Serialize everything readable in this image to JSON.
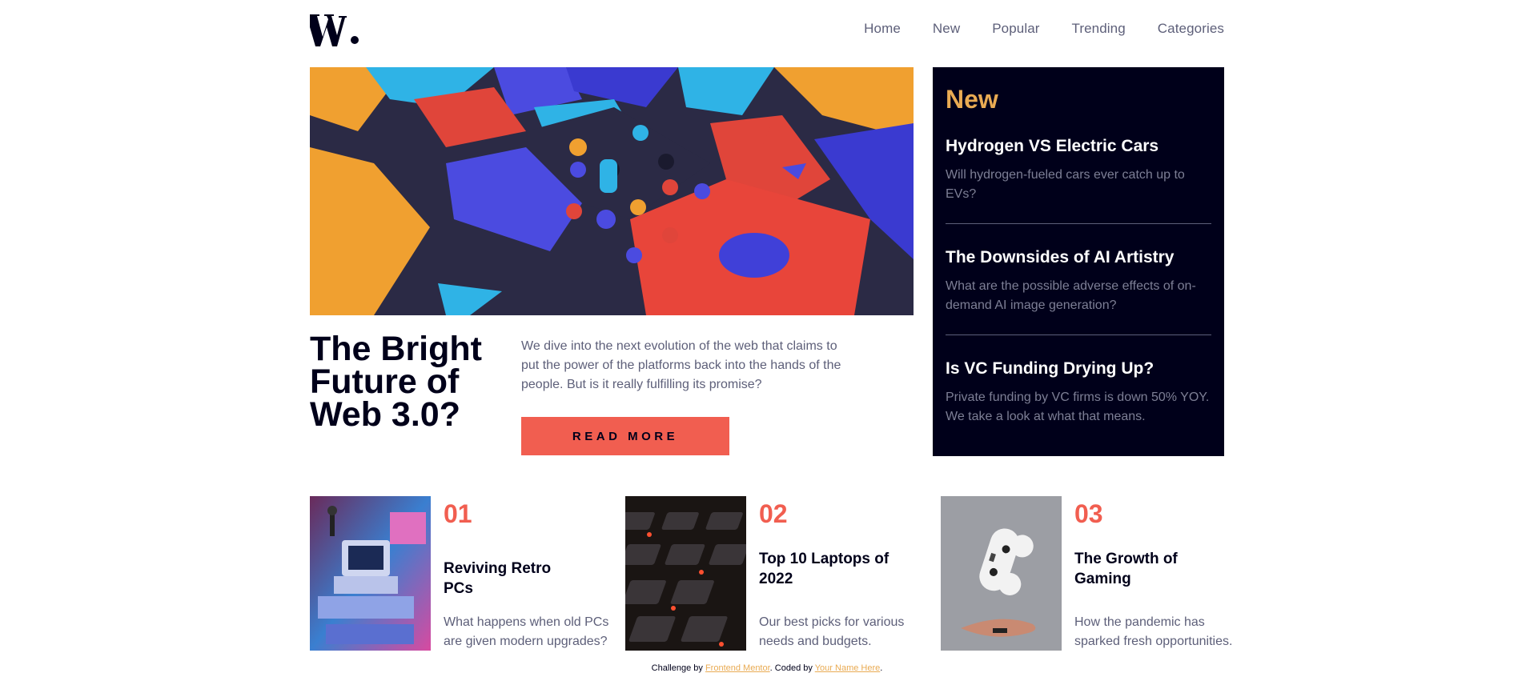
{
  "header": {
    "logo_text": "W.",
    "nav": [
      "Home",
      "New",
      "Popular",
      "Trending",
      "Categories"
    ]
  },
  "hero": {
    "image_icon": "abstract-3d-blocks-image",
    "title": "The Bright Future of Web 3.0?",
    "description": "We dive into the next evolution of the web that claims to put the power of the platforms back into the hands of the people. But is it really fulfilling its promise?",
    "button_label": "READ MORE"
  },
  "new_panel": {
    "heading": "New",
    "items": [
      {
        "title": "Hydrogen VS Electric Cars",
        "desc": "Will hydrogen-fueled cars ever catch up to EVs?"
      },
      {
        "title": "The Downsides of AI Artistry",
        "desc": "What are the possible adverse effects of on-demand AI image generation?"
      },
      {
        "title": "Is VC Funding Drying Up?",
        "desc": "Private funding by VC firms is down 50% YOY. We take a look at what that means."
      }
    ]
  },
  "cards": [
    {
      "num": "01",
      "title": "Reviving Retro PCs",
      "desc": "What happens when old PCs are given modern upgrades?",
      "image_icon": "retro-pc-image"
    },
    {
      "num": "02",
      "title": "Top 10 Laptops of 2022",
      "desc": "Our best picks for various needs and budgets.",
      "image_icon": "laptop-keyboard-image"
    },
    {
      "num": "03",
      "title": "The Growth of Gaming",
      "desc": "How the pandemic has sparked fresh opportunities.",
      "image_icon": "game-controller-image"
    }
  ],
  "footer": {
    "prefix": "Challenge by ",
    "link1": "Frontend Mentor",
    "middle": ". Coded by ",
    "link2": "Your Name Here",
    "suffix": "."
  },
  "colors": {
    "accent": "#f15e50",
    "accent_soft": "#e9ab53",
    "dark": "#00001a",
    "muted": "#5d5f79"
  }
}
